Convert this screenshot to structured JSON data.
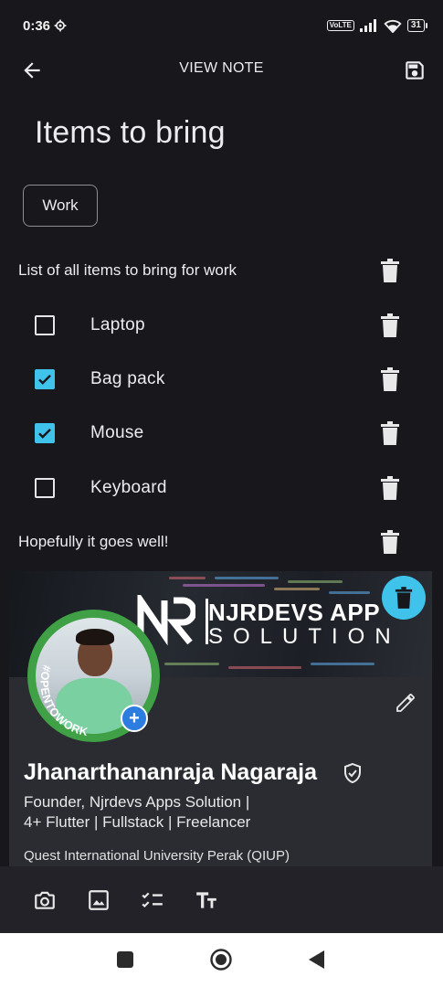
{
  "status_bar": {
    "time": "0:36",
    "network_badge": "VoLTE",
    "battery": "31"
  },
  "app_bar": {
    "title": "VIEW NOTE",
    "back_icon": "arrow-back-icon",
    "save_icon": "save-icon"
  },
  "note": {
    "title": "Items to bring",
    "tag": "Work",
    "blocks": [
      {
        "type": "text",
        "text": "List of all items to bring for work"
      },
      {
        "type": "checkbox",
        "label": "Laptop",
        "checked": false
      },
      {
        "type": "checkbox",
        "label": "Bag pack",
        "checked": true
      },
      {
        "type": "checkbox",
        "label": "Mouse",
        "checked": true
      },
      {
        "type": "checkbox",
        "label": "Keyboard",
        "checked": false
      },
      {
        "type": "text",
        "text": "Hopefully it goes well!"
      }
    ]
  },
  "image_card": {
    "banner_brand": "NJRDEVS APP",
    "banner_sub": "SOLUTION",
    "badge_text": "#OPENTOWORK",
    "profile_name": "Jhanarthananraja Nagaraja",
    "headline_line1": "Founder, Njrdevs Apps Solution |",
    "headline_line2": "4+ Flutter | Fullstack | Freelancer",
    "school": "Quest International University Perak (QIUP)"
  },
  "toolbar": {
    "items": [
      "camera-icon",
      "image-icon",
      "checklist-icon",
      "text-format-icon"
    ]
  },
  "colors": {
    "background": "#18171c",
    "accent": "#3fc3ea",
    "toolbar": "#222228",
    "card": "#2a2c31"
  }
}
